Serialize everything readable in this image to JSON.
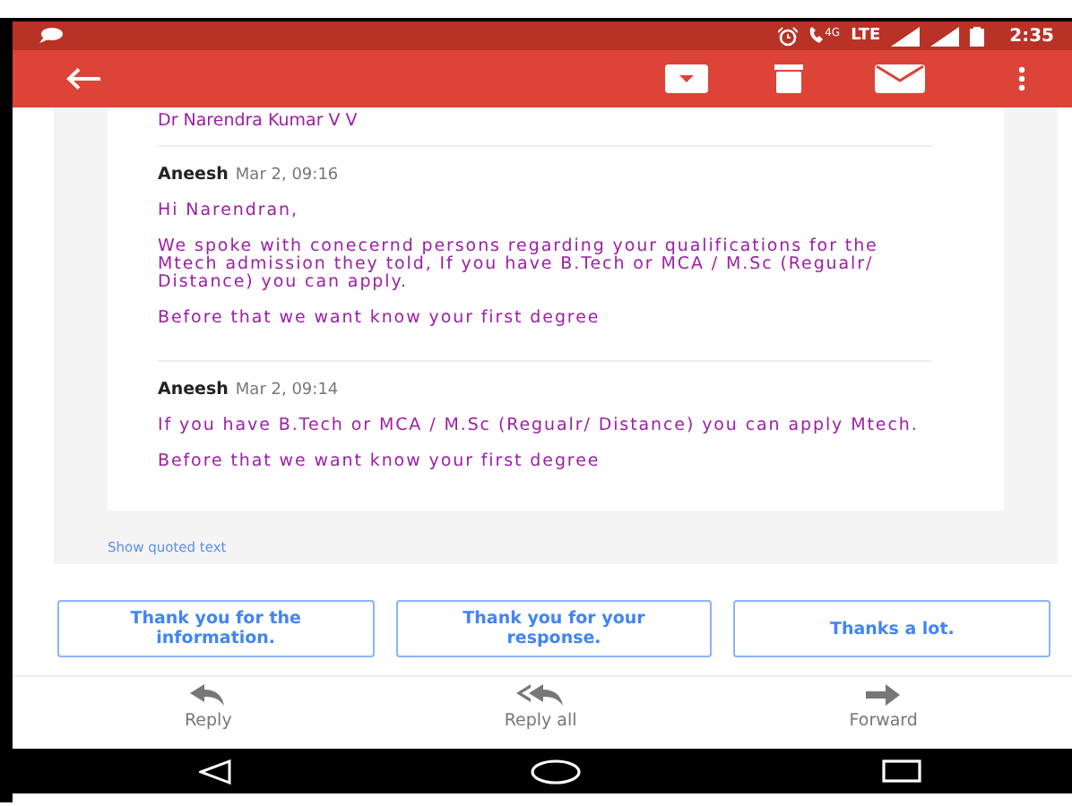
{
  "status_bar": {
    "call_label": "4G",
    "network": "LTE",
    "time": "2:35"
  },
  "thread": {
    "previous_sender": "Dr Narendra Kumar V V",
    "messages": [
      {
        "sender": "Aneesh",
        "date": "Mar 2, 09:16",
        "paragraphs": [
          "Hi Narendran,",
          "We spoke with conecernd persons regarding your qualifications for the Mtech admission they told, If you have B.Tech or MCA / M.Sc (Regualr/ Distance) you can apply.",
          "Before that we want know your first degree"
        ]
      },
      {
        "sender": "Aneesh",
        "date": "Mar 2, 09:14",
        "paragraphs": [
          "If you have B.Tech or MCA / M.Sc (Regualr/ Distance) you can apply Mtech.",
          "Before that we want know your first degree"
        ]
      }
    ],
    "show_quoted": "Show quoted text"
  },
  "smart_replies": [
    "Thank you for the information.",
    "Thank you for your response.",
    "Thanks a lot."
  ],
  "actions": [
    {
      "kind": "reply",
      "label": "Reply"
    },
    {
      "kind": "reply_all",
      "label": "Reply all"
    },
    {
      "kind": "forward",
      "label": "Forward"
    }
  ]
}
